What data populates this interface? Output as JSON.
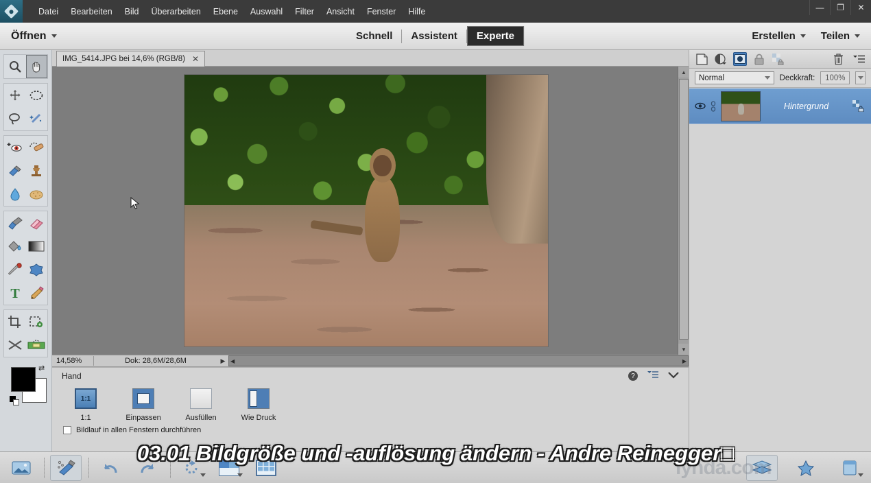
{
  "app": {
    "logo_icon": "photoshop-elements-logo",
    "menus": [
      "Datei",
      "Bearbeiten",
      "Bild",
      "Überarbeiten",
      "Ebene",
      "Auswahl",
      "Filter",
      "Ansicht",
      "Fenster",
      "Hilfe"
    ],
    "window_buttons": [
      {
        "name": "minimize",
        "glyph": "—"
      },
      {
        "name": "restore",
        "glyph": "❐"
      },
      {
        "name": "close",
        "glyph": "✕"
      }
    ]
  },
  "modebar": {
    "open_label": "Öffnen",
    "tabs": [
      {
        "label": "Schnell",
        "active": false
      },
      {
        "label": "Assistent",
        "active": false
      },
      {
        "label": "Experte",
        "active": true
      }
    ],
    "create_label": "Erstellen",
    "share_label": "Teilen"
  },
  "toolbar": {
    "groups": [
      {
        "name": "view-tools",
        "tools": [
          {
            "name": "zoom-tool",
            "icon": "magnifier-icon",
            "selected": false
          },
          {
            "name": "hand-tool",
            "icon": "hand-icon",
            "selected": true
          }
        ]
      },
      {
        "name": "selection-tools",
        "tools": [
          {
            "name": "move-tool",
            "icon": "move-arrows-icon",
            "selected": false
          },
          {
            "name": "marquee-tool",
            "icon": "elliptical-marquee-icon",
            "selected": false
          },
          {
            "name": "lasso-tool",
            "icon": "lasso-icon",
            "selected": false
          },
          {
            "name": "magic-wand-tool",
            "icon": "magic-wand-icon",
            "selected": false
          }
        ]
      },
      {
        "name": "retouch-tools",
        "tools": [
          {
            "name": "red-eye-tool",
            "icon": "red-eye-icon",
            "selected": false
          },
          {
            "name": "healing-brush-tool",
            "icon": "healing-bandage-icon",
            "selected": false
          },
          {
            "name": "smart-brush-tool",
            "icon": "smart-brush-icon",
            "selected": false
          },
          {
            "name": "clone-stamp-tool",
            "icon": "clone-stamp-icon",
            "selected": false
          },
          {
            "name": "blur-tool",
            "icon": "water-drop-icon",
            "selected": false
          },
          {
            "name": "sponge-tool",
            "icon": "sponge-icon",
            "selected": false
          }
        ]
      },
      {
        "name": "paint-tools",
        "tools": [
          {
            "name": "brush-tool",
            "icon": "paintbrush-icon",
            "selected": false
          },
          {
            "name": "eraser-tool",
            "icon": "eraser-icon",
            "selected": false
          },
          {
            "name": "paint-bucket-tool",
            "icon": "paint-bucket-icon",
            "selected": false
          },
          {
            "name": "gradient-tool",
            "icon": "gradient-icon",
            "selected": false
          },
          {
            "name": "eyedropper-tool",
            "icon": "eyedropper-icon",
            "selected": false
          },
          {
            "name": "custom-shape-tool",
            "icon": "blob-shape-icon",
            "selected": false
          },
          {
            "name": "type-tool",
            "icon": "text-t-icon",
            "selected": false
          },
          {
            "name": "pencil-tool",
            "icon": "pencil-icon",
            "selected": false
          }
        ]
      },
      {
        "name": "modify-tools",
        "tools": [
          {
            "name": "crop-tool",
            "icon": "crop-icon",
            "selected": false
          },
          {
            "name": "recompose-tool",
            "icon": "recompose-gear-icon",
            "selected": false
          },
          {
            "name": "content-aware-move-tool",
            "icon": "scissors-swap-icon",
            "selected": false
          },
          {
            "name": "straighten-tool",
            "icon": "straighten-level-icon",
            "selected": false
          }
        ]
      }
    ],
    "colors": {
      "foreground_hex": "#000000",
      "background_hex": "#ffffff",
      "swap_icon": "swap-arrows-icon",
      "default_icon": "default-colors-icon"
    }
  },
  "document": {
    "tab_title": "IMG_5414.JPG bei 14,6% (RGB/8)",
    "close_icon": "close-icon"
  },
  "statusbar": {
    "zoom_level": "14,58%",
    "doc_size": "Dok: 28,6M/28,6M",
    "triangle_icon": "play-triangle-icon"
  },
  "tool_options": {
    "title": "Hand",
    "help_icon": "help-question-icon",
    "menu_icon": "panel-menu-icon",
    "collapse_icon": "chevron-down-icon",
    "buttons": [
      {
        "name": "one-to-one",
        "label": "1:1",
        "swatch_text": "1:1",
        "selected": true
      },
      {
        "name": "fit-screen",
        "label": "Einpassen",
        "swatch_text": "",
        "selected": false
      },
      {
        "name": "fill-screen",
        "label": "Ausfüllen",
        "swatch_text": "",
        "selected": false
      },
      {
        "name": "print-size",
        "label": "Wie Druck",
        "swatch_text": "",
        "selected": false
      }
    ],
    "checkbox_label": "Bildlauf in allen Fenstern durchführen",
    "checkbox_checked": false
  },
  "layers_panel": {
    "toolbar_icons": [
      {
        "name": "new-layer-icon",
        "selected": false
      },
      {
        "name": "adjustment-layer-icon",
        "selected": false
      },
      {
        "name": "layer-mask-icon",
        "selected": true
      },
      {
        "name": "lock-icon",
        "selected": false
      },
      {
        "name": "lock-transparency-icon",
        "selected": false
      },
      {
        "name": "delete-layer-trash-icon",
        "selected": false
      },
      {
        "name": "panel-menu-icon",
        "selected": false
      }
    ],
    "blend_mode": "Normal",
    "opacity_label": "Deckkraft:",
    "opacity_value": "100%",
    "layers": [
      {
        "name": "Hintergrund",
        "visible": true,
        "locked": true,
        "selected": true,
        "eye_icon": "eye-icon",
        "link_icon": "link-icon",
        "lock_icon": "lock-badge-icon"
      }
    ]
  },
  "taskbar": {
    "items": [
      {
        "name": "photo-bin-button",
        "icon": "photo-bin-icon",
        "selected": false,
        "has_dropdown": false
      },
      {
        "name": "tool-options-button",
        "icon": "tool-options-icon",
        "selected": true,
        "has_dropdown": false
      },
      {
        "name": "undo-button",
        "icon": "undo-arrow-icon",
        "selected": false,
        "has_dropdown": false
      },
      {
        "name": "redo-button",
        "icon": "redo-arrow-icon",
        "selected": false,
        "has_dropdown": false
      },
      {
        "name": "rotate-button",
        "icon": "rotate-icon",
        "selected": false,
        "has_dropdown": true
      },
      {
        "name": "layout-button",
        "icon": "layout-icon",
        "selected": false,
        "has_dropdown": true
      },
      {
        "name": "organizer-button",
        "icon": "grid-organizer-icon",
        "selected": false,
        "has_dropdown": false
      },
      {
        "name": "layers-button",
        "icon": "layers-stack-icon",
        "selected": true,
        "has_dropdown": false
      },
      {
        "name": "effects-button",
        "icon": "effects-star-icon",
        "selected": false,
        "has_dropdown": false
      },
      {
        "name": "more-button",
        "icon": "more-panels-icon",
        "selected": false,
        "has_dropdown": true
      }
    ],
    "watermark_text": "lynda.com"
  },
  "subtitle": {
    "text": "03.01 Bildgröße und -auflösung ändern - Andre Reinegger□"
  },
  "cursor": {
    "icon": "arrow-cursor-icon"
  },
  "colors": {
    "menubar_bg": "#3b3b3b",
    "canvas_bg": "#7d7d7d",
    "panel_bg": "#d4d4d4",
    "layer_selected": "#6f9ed0",
    "accent_blue": "#4b82bf"
  }
}
